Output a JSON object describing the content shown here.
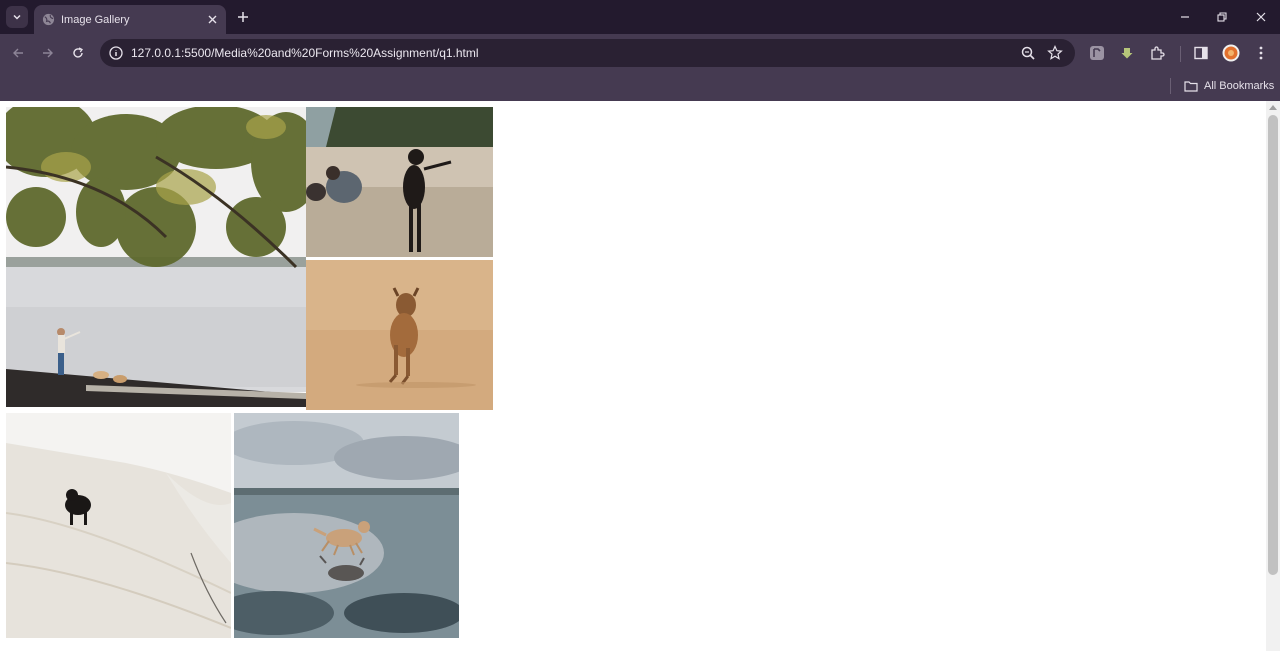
{
  "browser": {
    "tab_title": "Image Gallery",
    "url": "127.0.0.1:5500/Media%20and%20Forms%20Assignment/q1.html",
    "bookmarks_label": "All Bookmarks",
    "accent": "#453a51"
  },
  "gallery": {
    "images": [
      {
        "name": "tree-shore-photo",
        "description": "Person throwing ball to dogs on shore under tree branches"
      },
      {
        "name": "beach-black-dog-photo",
        "description": "Black dog walking on beach, person crouching"
      },
      {
        "name": "running-brown-dog-photo",
        "description": "Brown dog running on sand"
      },
      {
        "name": "black-dog-sand-photo",
        "description": "Black dog on white sandy beach"
      },
      {
        "name": "reflection-dog-photo",
        "description": "Dog running on wet beach with reflection"
      }
    ]
  }
}
